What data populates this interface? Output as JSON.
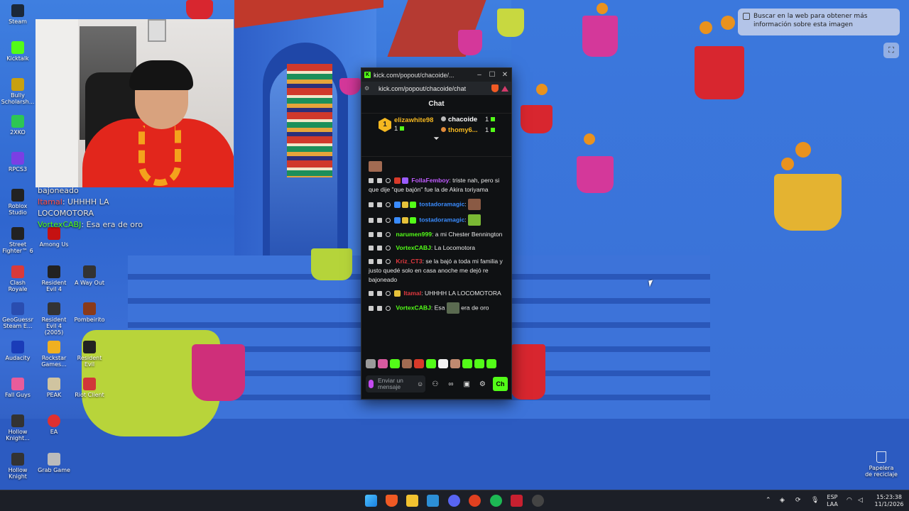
{
  "desktop_icons": [
    {
      "label": "Steam",
      "color": "#1b2838"
    },
    {
      "label": "Kicktalk",
      "color": "#53fc18"
    },
    {
      "label": "Bully Scholarsh...",
      "color": "#c8a010"
    },
    {
      "label": "2XKO",
      "color": "#2dc653"
    },
    {
      "label": "RPCS3",
      "color": "#7b3fe4"
    },
    {
      "label": "Roblox Studio",
      "color": "#222222"
    },
    {
      "label": "Street Fighter™ 6",
      "color": "#222222"
    },
    {
      "label": "Clash Royale",
      "color": "#d93a3a"
    },
    {
      "label": "GeoGuessr Steam E...",
      "color": "#2a4db0"
    },
    {
      "label": "Audacity",
      "color": "#1a3cb8"
    },
    {
      "label": "Fall Guys",
      "color": "#e85c9b"
    },
    {
      "label": "Hollow Knight...",
      "color": "#333333"
    },
    {
      "label": "Hollow Knight",
      "color": "#333333"
    },
    {
      "label": "Among Us",
      "color": "#c51111"
    },
    {
      "label": "Resident Evil 4",
      "color": "#222222"
    },
    {
      "label": "Resident Evil 4 (2005)",
      "color": "#333333"
    },
    {
      "label": "Rockstar Games...",
      "color": "#f0b020"
    },
    {
      "label": "PEAK",
      "color": "#d0c4a0"
    },
    {
      "label": "EA",
      "color": "#e03030"
    },
    {
      "label": "Grab Game",
      "color": "#bbbbbb"
    },
    {
      "label": "A Way Out",
      "color": "#333333"
    },
    {
      "label": "Pombeirito",
      "color": "#8a3a1a"
    },
    {
      "label": "Resident Evil",
      "color": "#222222"
    },
    {
      "label": "Riot Client",
      "color": "#d13639"
    }
  ],
  "ghost_chat": {
    "line1": "bajoneado",
    "line2_user": "Itamal",
    "line2_text": ": UHHHH LA",
    "line3": "LOCOMOTORA",
    "line4_user": "VortexCABJ",
    "line4_text": ": Esa",
    "line4_tail": "era de oro"
  },
  "lens": {
    "tooltip": "Buscar en la web para obtener más información sobre esta imagen"
  },
  "popup": {
    "window_title": "kick.com/popout/chacoide/...",
    "url": "kick.com/popout/chacoide/chat",
    "chat_title": "Chat",
    "leaderboard": [
      {
        "rank": "1",
        "name": "elizawhite98",
        "count": "1"
      },
      {
        "name": "chacoide",
        "count": "1"
      },
      {
        "name": "thomy6...",
        "count": "1"
      }
    ],
    "messages": [
      {
        "user": "FollaFemboy",
        "user_color": "#c05cff",
        "text": ": triste nah, pero si que dije \"que bajón\" fue la de Akira toriyama"
      },
      {
        "user": "tostadoramagic",
        "user_color": "#3a8cff",
        "text": ":"
      },
      {
        "user": "tostadoramagic",
        "user_color": "#3a8cff",
        "text": ":"
      },
      {
        "user": "narumen999",
        "user_color": "#53fc18",
        "text": ": a mi Chester Bennington"
      },
      {
        "user": "VortexCABJ",
        "user_color": "#53fc18",
        "text": ": La Locomotora"
      },
      {
        "user": "Kriz_CT3",
        "user_color": "#e0383e",
        "text": ": se la bajó a toda mi familia y justo quedé solo en casa anoche me dejó re bajoneado"
      },
      {
        "user": "Itamal",
        "user_color": "#e0383e",
        "text": ": UHHHH LA LOCOMOTORA"
      },
      {
        "user": "VortexCABJ",
        "user_color": "#53fc18",
        "text": ": Esa",
        "tail": "era de oro"
      }
    ],
    "composer": {
      "placeholder": "Enviar un mensaje",
      "send_label": "Ch"
    }
  },
  "recycle_bin": {
    "label": "Papelera de reciclaje"
  },
  "tray": {
    "lang_top": "ESP",
    "lang_bottom": "LAA",
    "time": "15:23:38",
    "date": "11/1/2026"
  }
}
